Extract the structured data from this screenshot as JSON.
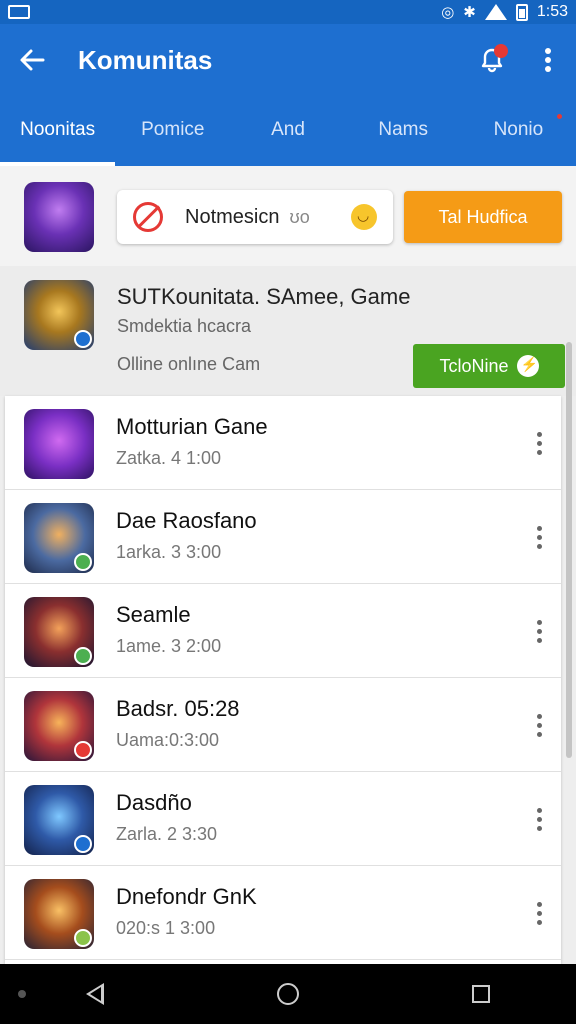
{
  "status_bar": {
    "time": "1:53",
    "icons": [
      "circle-icon",
      "bluetooth-icon",
      "wifi-icon",
      "battery-icon"
    ]
  },
  "app_bar": {
    "title": "Komunitas",
    "icons": [
      "back-arrow-icon",
      "bell-icon",
      "more-vert-icon"
    ]
  },
  "tabs": [
    {
      "label": "Noonitas",
      "active": true
    },
    {
      "label": "Pomice"
    },
    {
      "label": "And"
    },
    {
      "label": "Nams"
    },
    {
      "label": "Nonio"
    }
  ],
  "top_card": {
    "notice_text": "Notmesicn",
    "notice_sub": "ʊo",
    "action_button": "Tal Hudfica"
  },
  "featured": {
    "title": "SUTKounitata. SAmee, Game",
    "subtitle": "Smdektia hcacra",
    "status": "Olline onlıne Cam",
    "button_label": "TcloNine"
  },
  "list": [
    {
      "title": "Motturian Gane",
      "time": "Zatka. 4 1:00",
      "badge_color": "#1e6fd0"
    },
    {
      "title": "Dae Raosfano",
      "time": "1arka. 3 3:00",
      "badge_color": "#4caf50"
    },
    {
      "title": "Seamle",
      "time": "1ame. 3 2:00",
      "badge_color": "#4caf50"
    },
    {
      "title": "Badsr. 05:28",
      "time": "Uama:0:3:00",
      "badge_color": "#e53935"
    },
    {
      "title": "Dasdño",
      "time": "Zarla. 2 3:30",
      "badge_color": "#1e6fd0"
    },
    {
      "title": "Dnefondr GnK",
      "time": "020:s 1 3:00",
      "badge_color": "#8bc34a"
    }
  ],
  "colors": {
    "primary": "#1e6fd0",
    "orange": "#f59b16",
    "green": "#4aa421"
  }
}
